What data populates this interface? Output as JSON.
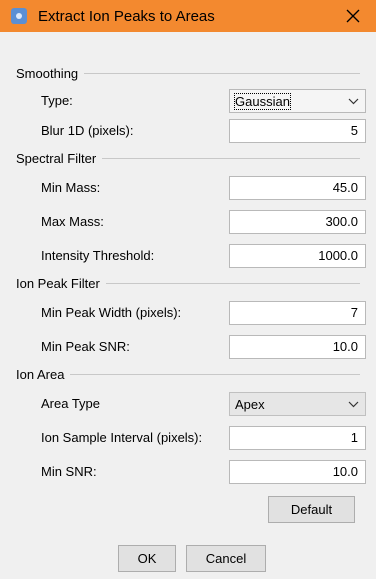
{
  "window": {
    "title": "Extract Ion Peaks to Areas",
    "close_symbol": "X",
    "accent": "#f3892f"
  },
  "groups": {
    "smoothing": "Smoothing",
    "spectral_filter": "Spectral Filter",
    "ion_peak_filter": "Ion Peak Filter",
    "ion_area": "Ion Area"
  },
  "fields": {
    "type": {
      "label": "Type:",
      "value": "Gaussian"
    },
    "blur": {
      "label": "Blur 1D (pixels):",
      "value": "5"
    },
    "min_mass": {
      "label": "Min Mass:",
      "value": "45.0"
    },
    "max_mass": {
      "label": "Max Mass:",
      "value": "300.0"
    },
    "intensity_threshold": {
      "label": "Intensity Threshold:",
      "value": "1000.0"
    },
    "min_peak_width": {
      "label": "Min Peak Width (pixels):",
      "value": "7"
    },
    "min_peak_snr": {
      "label": "Min Peak SNR:",
      "value": "10.0"
    },
    "area_type": {
      "label": "Area Type",
      "value": "Apex"
    },
    "ion_sample_interval": {
      "label": "Ion Sample Interval (pixels):",
      "value": "1"
    },
    "min_snr": {
      "label": "Min SNR:",
      "value": "10.0"
    }
  },
  "buttons": {
    "default": "Default",
    "ok": "OK",
    "cancel": "Cancel"
  }
}
